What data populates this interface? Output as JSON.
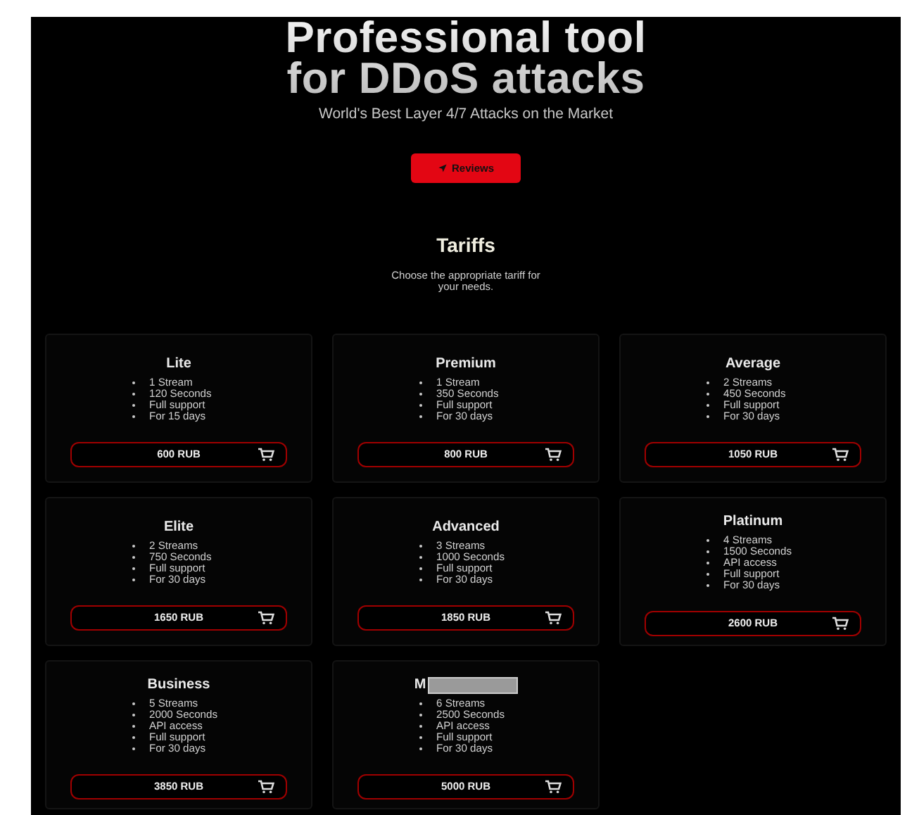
{
  "hero": {
    "title_lines": [
      "Professional tool",
      "for DDoS attacks"
    ],
    "subtitle": "World's Best Layer 4/7 Attacks on the Market",
    "button": "Reviews"
  },
  "tariffs": {
    "heading": "Tariffs",
    "description": "Choose the appropriate tariff for your needs.",
    "plans": [
      {
        "name": "Lite",
        "redacted": false,
        "features": [
          "1 Stream",
          "120 Seconds",
          "Full support",
          "For 15 days"
        ],
        "price": "600 RUB"
      },
      {
        "name": "Premium",
        "redacted": false,
        "features": [
          "1 Stream",
          "350 Seconds",
          "Full support",
          "For 30 days"
        ],
        "price": "800 RUB"
      },
      {
        "name": "Average",
        "redacted": false,
        "features": [
          "2 Streams",
          "450 Seconds",
          "Full support",
          "For 30 days"
        ],
        "price": "1050 RUB"
      },
      {
        "name": "Elite",
        "redacted": false,
        "features": [
          "2 Streams",
          "750 Seconds",
          "Full support",
          "For 30 days"
        ],
        "price": "1650 RUB"
      },
      {
        "name": "Advanced",
        "redacted": false,
        "features": [
          "3 Streams",
          "1000 Seconds",
          "Full support",
          "For 30 days"
        ],
        "price": "1850 RUB"
      },
      {
        "name": "Platinum",
        "redacted": false,
        "features": [
          "4 Streams",
          "1500 Seconds",
          "API access",
          "Full support",
          "For 30 days"
        ],
        "price": "2600 RUB"
      },
      {
        "name": "Business",
        "redacted": false,
        "features": [
          "5 Streams",
          "2000 Seconds",
          "API access",
          "Full support",
          "For 30 days"
        ],
        "price": "3850 RUB"
      },
      {
        "name": "M",
        "redacted": true,
        "features": [
          "6 Streams",
          "2500 Seconds",
          "API access",
          "Full support",
          "For 30 days"
        ],
        "price": "5000 RUB"
      }
    ]
  }
}
